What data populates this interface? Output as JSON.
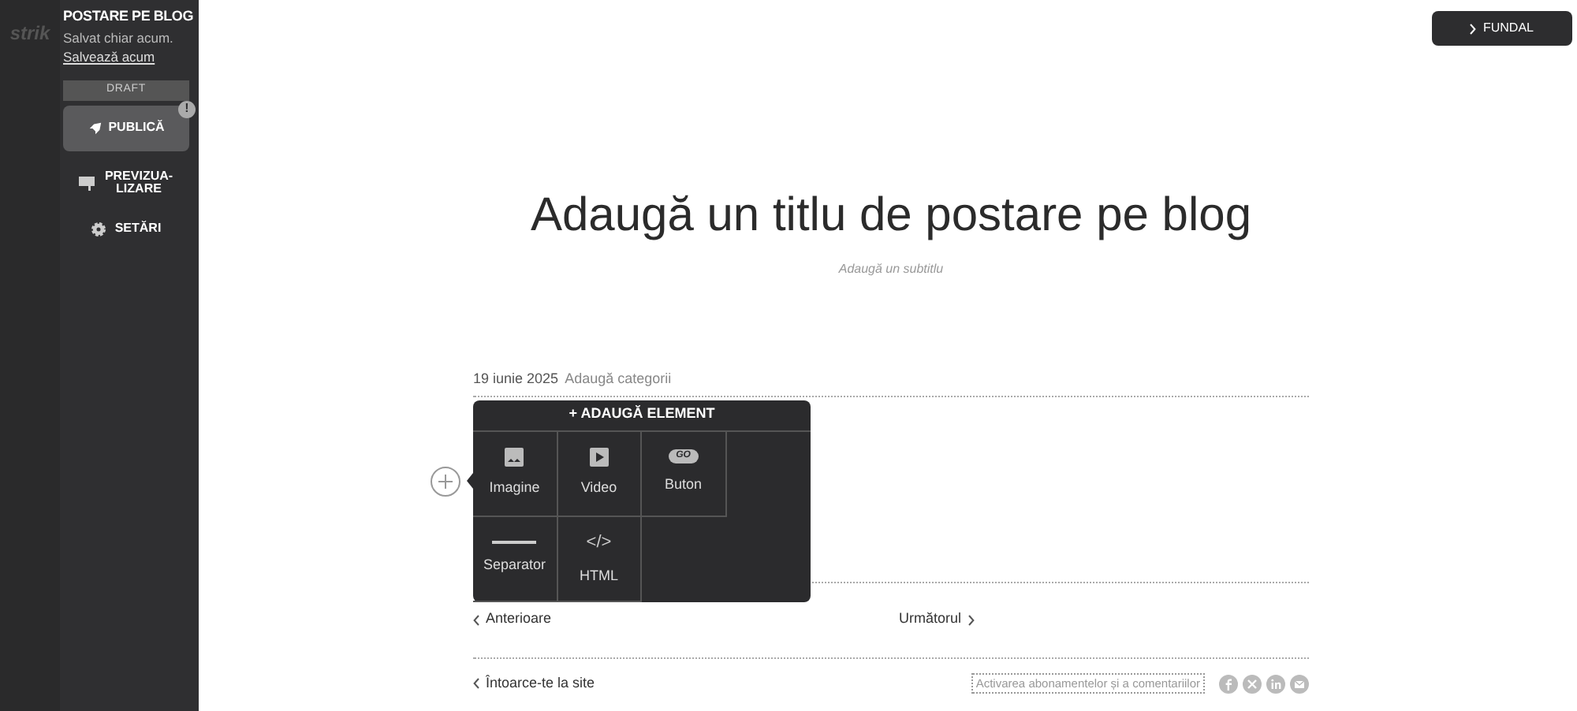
{
  "background_app": {
    "logo": "strik"
  },
  "panel": {
    "title": "POSTARE PE BLOG",
    "save_status": "Salvat chiar acum.",
    "save_link": "Salvează acum",
    "badge": "DRAFT",
    "publish": {
      "label": "PUBLICĂ",
      "warning": "!"
    },
    "actions": [
      {
        "kind": "preview",
        "label": "PREVIZUA-\nLIZARE"
      },
      {
        "kind": "settings",
        "label": "SETĂRI"
      }
    ]
  },
  "background_button": "FUNDAL",
  "post": {
    "title": "Adaugă un titlu de postare pe blog",
    "subtitle": "Adaugă un subtitlu",
    "date": "19 iunie 2025",
    "category_link": "Adaugă categorii"
  },
  "add_element": {
    "title": "+ ADAUGĂ ELEMENT",
    "items": [
      {
        "kind": "image",
        "label": "Imagine"
      },
      {
        "kind": "video",
        "label": "Video"
      },
      {
        "kind": "button",
        "label": "Buton",
        "icon_text": "GO"
      },
      {
        "kind": "separator",
        "label": "Separator"
      },
      {
        "kind": "html",
        "label": "HTML",
        "icon_text": "</>"
      }
    ]
  },
  "navigation": {
    "previous": "Anterioare",
    "next": "Următorul"
  },
  "footer": {
    "back": "Întoarce-te la site",
    "subscribe": "Activarea abonamentelor și a comentariilor",
    "social": [
      {
        "kind": "facebook"
      },
      {
        "kind": "x"
      },
      {
        "kind": "linkedin"
      },
      {
        "kind": "email"
      }
    ]
  }
}
